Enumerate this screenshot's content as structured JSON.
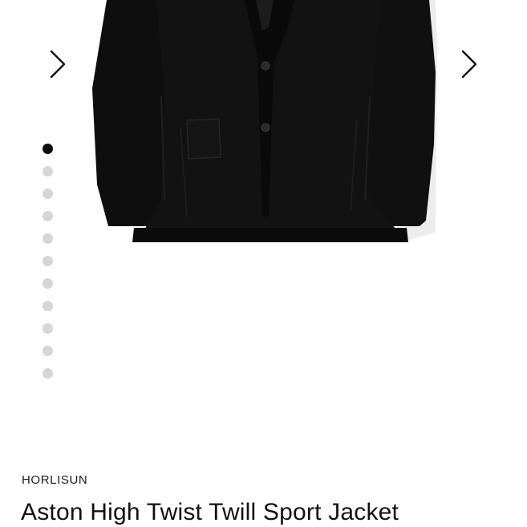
{
  "gallery": {
    "image": "black-sport-jacket-photo",
    "prev_icon": "chevron-right-icon",
    "next_icon": "chevron-right-icon",
    "slide_count": 11,
    "active_slide": 1,
    "dot_colors": {
      "active": "#0d0d0d",
      "inactive": "#d6d6d6"
    }
  },
  "product": {
    "brand": "HORLISUN",
    "title": "Aston High Twist Twill Sport Jacket"
  }
}
